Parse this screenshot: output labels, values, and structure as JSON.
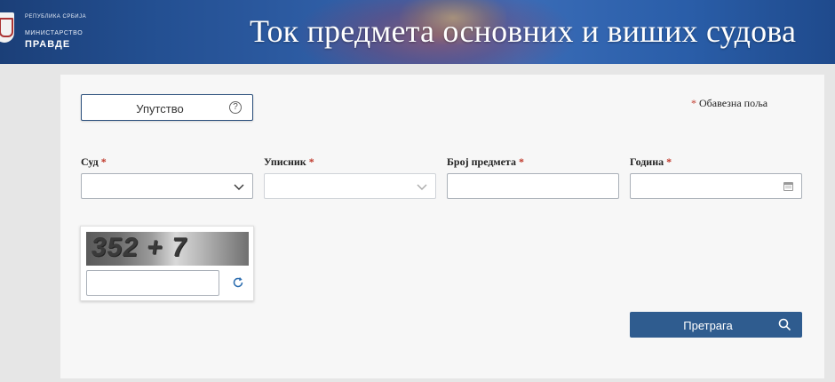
{
  "header": {
    "logo_top": "РЕПУБЛИКА СРБИЈА",
    "logo_mid": "МИНИСТАРСТВО",
    "logo_bottom": "ПРАВДЕ",
    "title": "Ток предмета основних и виших судова"
  },
  "form": {
    "help_button_label": "Упутство",
    "required_note": "Обавезна поља",
    "required_mark": "*",
    "fields": [
      {
        "label": "Суд",
        "type": "select",
        "value": "",
        "disabled": false
      },
      {
        "label": "Уписник",
        "type": "select",
        "value": "",
        "disabled": true
      },
      {
        "label": "Број предмета",
        "type": "text",
        "value": "",
        "disabled": false
      },
      {
        "label": "Година",
        "type": "date",
        "value": "",
        "disabled": false
      }
    ],
    "captcha": {
      "image_text": "352 + 7",
      "input_value": ""
    },
    "search_button_label": "Претрага"
  },
  "icons": {
    "help": "question-circle-icon",
    "select": "chevron-down-icon",
    "calendar": "calendar-icon",
    "refresh": "refresh-icon",
    "search": "search-icon"
  },
  "colors": {
    "primary": "#2f5c8f",
    "required": "#c0392b",
    "header": "#2a5ea9"
  }
}
